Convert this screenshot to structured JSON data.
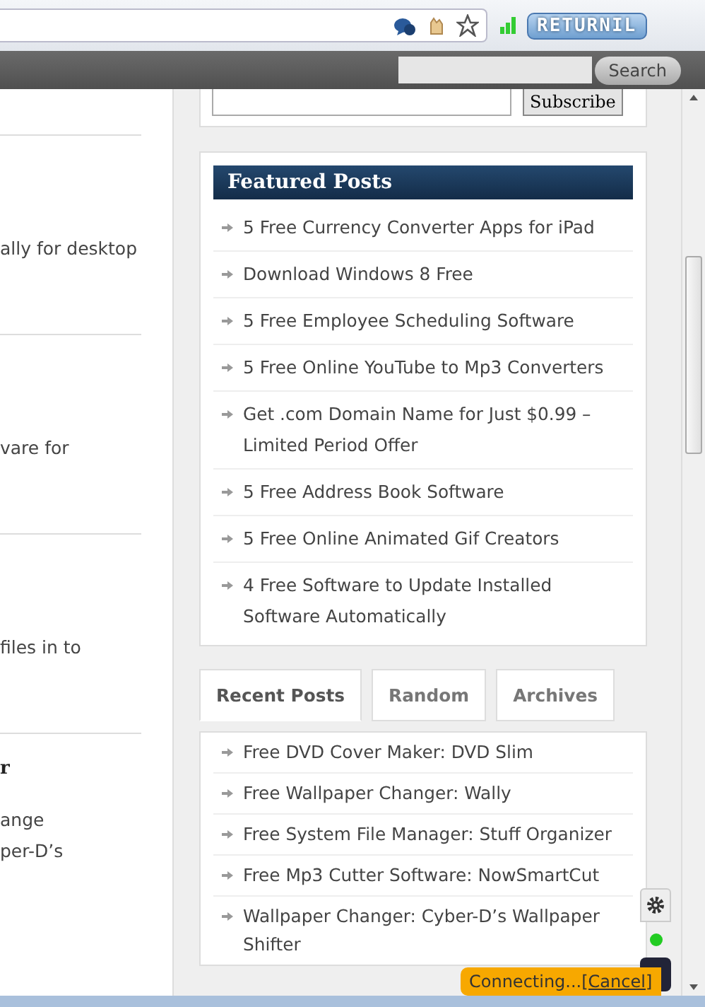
{
  "browser": {
    "badge": "RETURNIL"
  },
  "top_bar": {
    "search_button": "Search"
  },
  "subscribe": {
    "button": "Subscribe"
  },
  "posts": [
    {
      "excerpt_lines": [
        "ally for desktop"
      ]
    },
    {
      "excerpt_lines": [
        "vare for"
      ]
    },
    {
      "excerpt_lines": [
        "files in to"
      ]
    },
    {
      "title": "r",
      "excerpt_lines": [
        "ange",
        "per-D’s"
      ]
    }
  ],
  "featured": {
    "title": "Featured Posts",
    "items": [
      "5 Free Currency Converter Apps for iPad",
      "Download Windows 8 Free",
      "5 Free Employee Scheduling Software",
      "5 Free Online YouTube to Mp3 Converters",
      "Get .com Domain Name for Just $0.99 – Limited Period Offer",
      "5 Free Address Book Software",
      "5 Free Online Animated Gif Creators",
      "4 Free Software to Update Installed Software Automatically"
    ]
  },
  "tabs": [
    {
      "label": "Recent Posts",
      "selected": true
    },
    {
      "label": "Random",
      "selected": false
    },
    {
      "label": "Archives",
      "selected": false
    }
  ],
  "recent": [
    "Free DVD Cover Maker: DVD Slim",
    "Free Wallpaper Changer: Wally",
    "Free System File Manager: Stuff Organizer",
    "Free Mp3 Cutter Software: NowSmartCut",
    "Wallpaper Changer: Cyber-D’s Wallpaper Shifter"
  ],
  "toast": {
    "text": "Connecting...",
    "link": "[Cancel]"
  }
}
